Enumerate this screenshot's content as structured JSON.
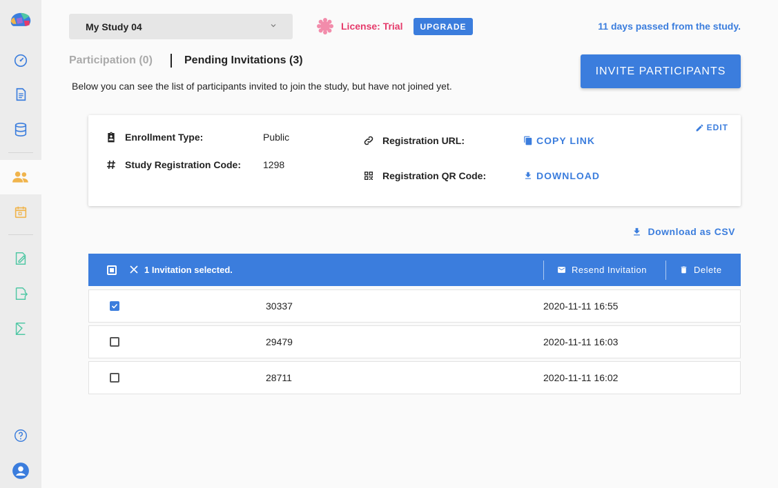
{
  "header": {
    "study_name": "My Study 04",
    "license_label": "License: Trial",
    "upgrade_label": "UPGRADE",
    "days_text": "11 days passed from the study."
  },
  "tabs": {
    "participation": "Participation (0)",
    "pending": "Pending Invitations (3)"
  },
  "invite_button": "INVITE PARTICIPANTS",
  "description": "Below you can see the list of participants invited to join the study, but have not joined yet.",
  "card": {
    "edit_label": "EDIT",
    "enrollment_type_label": "Enrollment Type:",
    "enrollment_type_value": "Public",
    "registration_code_label": "Study Registration Code:",
    "registration_code_value": "1298",
    "registration_url_label": "Registration URL:",
    "copy_link_label": "COPY LINK",
    "qr_code_label": "Registration QR Code:",
    "download_label": "DOWNLOAD"
  },
  "download_csv_label": "Download as CSV",
  "selection_bar": {
    "text": "1 Invitation selected.",
    "resend_label": "Resend Invitation",
    "delete_label": "Delete"
  },
  "rows": [
    {
      "id": "30337",
      "date": "2020-11-11 16:55",
      "checked": true
    },
    {
      "id": "29479",
      "date": "2020-11-11 16:03",
      "checked": false
    },
    {
      "id": "28711",
      "date": "2020-11-11 16:02",
      "checked": false
    }
  ],
  "colors": {
    "accent": "#3b7ddd",
    "license": "#e53a6a",
    "sidebar_people": "#f0b44c",
    "sidebar_teal": "#4fc7a4"
  },
  "sidebar_icons": [
    "brain-logo-icon",
    "dashboard-icon",
    "document-icon",
    "database-icon",
    "participants-icon",
    "calendar-icon",
    "edit-document-icon",
    "export-icon",
    "analytics-icon",
    "help-icon",
    "account-icon"
  ]
}
